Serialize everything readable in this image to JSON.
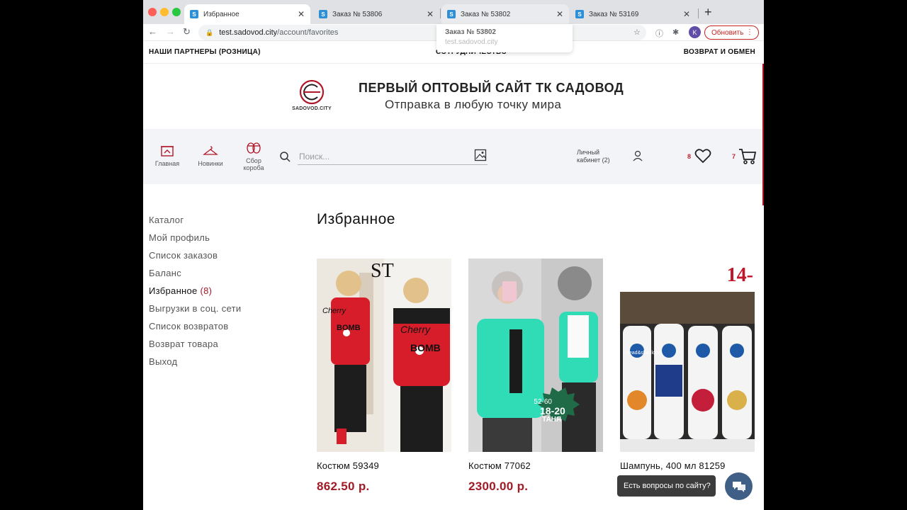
{
  "browser": {
    "tabs": [
      {
        "label": "Избранное",
        "active": true
      },
      {
        "label": "Заказ № 53806",
        "active": false
      },
      {
        "label": "Заказ № 53802",
        "active": false
      },
      {
        "label": "Заказ № 53169",
        "active": false
      }
    ],
    "favicon_letter": "S",
    "url_host": "test.sadovod.city",
    "url_path": "/account/favorites",
    "profile_initial": "K",
    "update_label": "Обновить",
    "tooltip": {
      "title": "Заказ № 53802",
      "url": "test.sadovod.city"
    },
    "colors": {
      "tab_bar": "#dfe1e5",
      "close": "#ff5f57",
      "minimize": "#febc2e",
      "maximize": "#28c840",
      "favicon": "#2d8fd5"
    }
  },
  "top_links": {
    "partners": "НАШИ ПАРТНЕРЫ (РОЗНИЦА)",
    "cooperation": "СОТРУДНИЧЕСТВО",
    "returns": "ВОЗВРАТ И ОБМЕН"
  },
  "header": {
    "logo_text": "SADOVOD.CITY",
    "title": "ПЕРВЫЙ ОПТОВЫЙ САЙТ ТК САДОВОД",
    "subtitle": "Отправка в любую точку мира"
  },
  "nav": {
    "home": "Главная",
    "new_items": "Новинки",
    "box_line1": "Сбор",
    "box_line2": "короба",
    "search_placeholder": "Поиск...",
    "cabinet_line1": "Личный",
    "cabinet_line2": "кабинет (2)",
    "favorites_count": "8",
    "cart_count": "7"
  },
  "sidebar": {
    "items": [
      "Каталог",
      "Мой профиль",
      "Список заказов",
      "Баланс",
      "Избранное",
      "Выгрузки в соц. сети",
      "Список возвратов",
      "Возврат товара",
      "Выход"
    ],
    "favorites_count": "(8)"
  },
  "main": {
    "title": "Избранное",
    "products": [
      {
        "name": "Костюм 59349",
        "price": "862.50 р.",
        "image_texts": [
          "ST",
          "Cherry",
          "BOMB"
        ]
      },
      {
        "name": "Костюм 77062",
        "price": "2300.00 р.",
        "badge_top": "52-60",
        "badge_mid": "18-20",
        "badge_bottom": "ТАНЯ"
      },
      {
        "name": "Шампунь, 400 мл 81259",
        "price": "",
        "image_corner": "14-",
        "bottle_brand": "head&shoulders"
      }
    ]
  },
  "chat": {
    "label": "Есть вопросы по сайту?"
  },
  "accent_color": "#a01b26"
}
